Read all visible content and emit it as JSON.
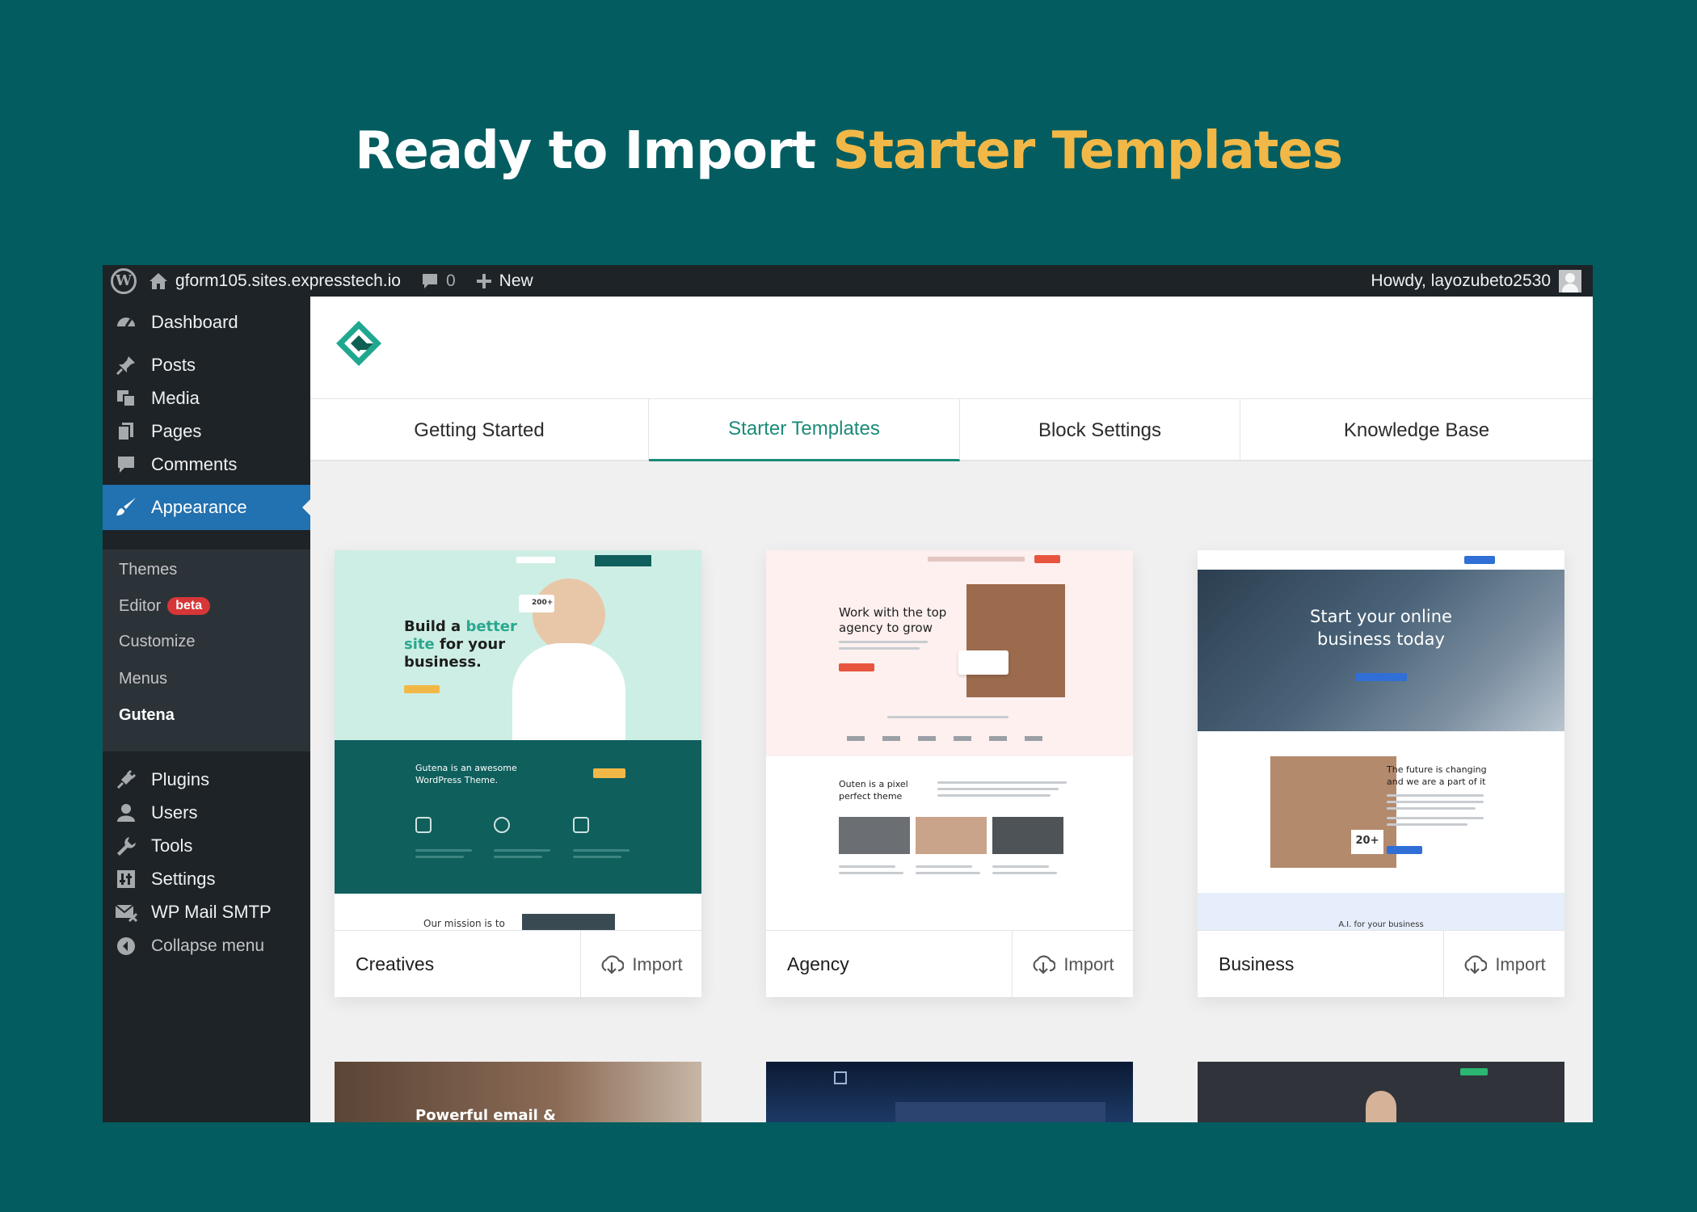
{
  "headline": {
    "part1": "Ready to Import ",
    "part2": "Starter Templates"
  },
  "adminbar": {
    "site": "gform105.sites.expresstech.io",
    "comments": "0",
    "new": "New",
    "howdy": "Howdy, layozubeto2530"
  },
  "sidebar": {
    "dashboard": "Dashboard",
    "posts": "Posts",
    "media": "Media",
    "pages": "Pages",
    "comments": "Comments",
    "appearance": "Appearance",
    "sub": {
      "themes": "Themes",
      "editor": "Editor",
      "beta": "beta",
      "customize": "Customize",
      "menus": "Menus",
      "gutena": "Gutena"
    },
    "plugins": "Plugins",
    "users": "Users",
    "tools": "Tools",
    "settings": "Settings",
    "smtp": "WP Mail SMTP",
    "collapse": "Collapse menu"
  },
  "tabs": [
    "Getting Started",
    "Starter Templates",
    "Block Settings",
    "Knowledge Base"
  ],
  "import_label": "Import",
  "cards": [
    {
      "name": "Creatives",
      "hero1": "Build a ",
      "hero2": "better",
      "hero3": "site",
      "hero4": " for your",
      "hero5": "business.",
      "band": "Gutena is an awesome",
      "band2": "WordPress Theme.",
      "mission": "Our mission is to",
      "stat": "200+"
    },
    {
      "name": "Agency",
      "hero1": "Work with the top",
      "hero2": "agency to grow",
      "mid1": "Outen is a pixel",
      "mid2": "perfect theme"
    },
    {
      "name": "Business",
      "hero1": "Start your online",
      "hero2": "business today",
      "mid1": "The future is changing",
      "mid2": "and we are a part of it",
      "stat": "20+",
      "foot": "A.I. for your business"
    }
  ],
  "row2": {
    "first": "Powerful email &"
  },
  "colors": {
    "accent": "#f2b847",
    "bg": "#035d60",
    "wpblue": "#2271b1",
    "teal": "#1b8a78"
  }
}
